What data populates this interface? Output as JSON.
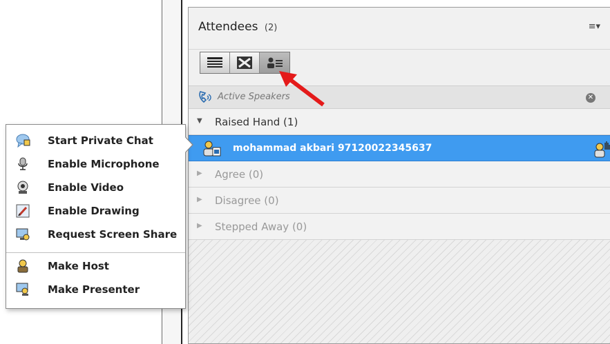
{
  "pod": {
    "title": "Attendees",
    "count": "(2)",
    "menu_icon": "≡▾",
    "views": [
      "list-view-icon",
      "breakout-view-icon",
      "attendee-status-view-icon"
    ],
    "active_speakers_label": "Active Speakers",
    "close_glyph": "✕",
    "groups": [
      {
        "label": "Raised Hand (1)",
        "expanded": true
      },
      {
        "label": "Agree (0)",
        "expanded": false
      },
      {
        "label": "Disagree (0)",
        "expanded": false
      },
      {
        "label": "Stepped Away (0)",
        "expanded": false
      }
    ],
    "attendee": {
      "name": "mohammad akbari 97120022345637",
      "selected_color": "#3f9bf0"
    },
    "glyphs": {
      "expanded": "▼",
      "collapsed": "▶"
    }
  },
  "context_menu": {
    "items": [
      {
        "label": "Start Private Chat",
        "icon": "chat-bubble-icon"
      },
      {
        "label": "Enable Microphone",
        "icon": "microphone-icon"
      },
      {
        "label": "Enable Video",
        "icon": "webcam-icon"
      },
      {
        "label": "Enable Drawing",
        "icon": "pencil-drawing-icon"
      },
      {
        "label": "Request Screen Share",
        "icon": "screen-share-icon"
      },
      {
        "label": "Make Host",
        "icon": "host-icon"
      },
      {
        "label": "Make Presenter",
        "icon": "presenter-icon"
      }
    ]
  },
  "annotation": {
    "color": "#e41a1a"
  }
}
